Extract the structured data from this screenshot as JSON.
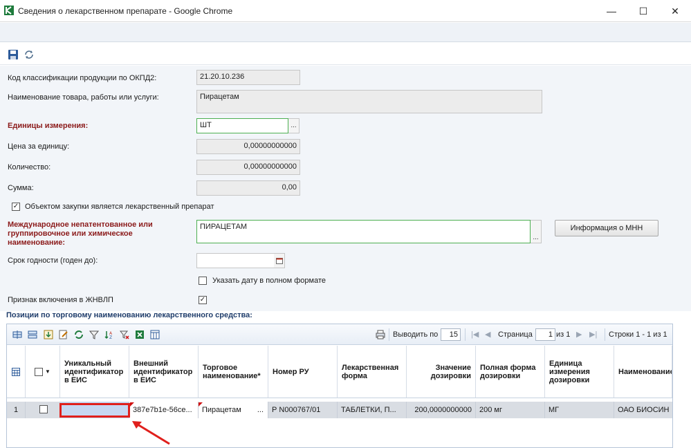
{
  "window": {
    "title": "Сведения о лекарственном препарате - Google Chrome",
    "controls": [
      "—",
      "☐",
      "✕"
    ]
  },
  "form": {
    "okpd2": {
      "label": "Код классификации продукции по ОКПД2:",
      "value": "21.20.10.236"
    },
    "name": {
      "label": "Наименование товара, работы или услуги:",
      "value": "Пирацетам"
    },
    "units": {
      "label": "Единицы измерения:",
      "value": "ШТ"
    },
    "price": {
      "label": "Цена за единицу:",
      "value": "0,00000000000"
    },
    "quantity": {
      "label": "Количество:",
      "value": "0,00000000000"
    },
    "sum": {
      "label": "Сумма:",
      "value": "0,00"
    },
    "is_drug": {
      "label": "Объектом закупки является лекарственный препарат",
      "checked": true
    },
    "mnn": {
      "label": "Международное непатентованное или группировочное или химическое наименование:",
      "value": "ПИРАЦЕТАМ",
      "info_button": "Информация о МНН"
    },
    "expiry": {
      "label": "Срок годности (годен до):",
      "value": ""
    },
    "full_date": {
      "label": "Указать дату в полном формате",
      "checked": false
    },
    "zhnvlp": {
      "label": "Признак включения в ЖНВЛП",
      "checked": true
    },
    "dots": "..."
  },
  "grid": {
    "section_title": "Позиции по торговому наименованию лекарственного средства:",
    "pager": {
      "show_label": "Выводить по",
      "per_page": "15",
      "page_label": "Страница",
      "page": "1",
      "of_label": "из 1",
      "rows_label": "Строки 1 - 1 из 1"
    },
    "columns": [
      "Уникальный идентификатор в ЕИС",
      "Внешний идентификатор в ЕИС",
      "Торговое наименование*",
      "Номер РУ",
      "Лекарственная форма",
      "Значение дозировки",
      "Полная форма дозировки",
      "Единица измерения дозировки",
      "Наименование держателя или владельца РУ"
    ],
    "rows": [
      {
        "num": "1",
        "checked": false,
        "uid": "",
        "ext_id": "387e7b1e-56ce...",
        "trade_name": "Пирацетам",
        "trade_dots": "...",
        "ru_number": "Р N000767/01",
        "form": "ТАБЛЕТКИ, П...",
        "dose_value": "200,0000000000",
        "dose_full": "200 мг",
        "dose_unit": "МГ",
        "holder": "ОАО БИОСИН"
      }
    ]
  },
  "colors": {
    "accent_red": "#e0201c",
    "required_label": "#8b1a1a",
    "section_title": "#1f3d6b"
  }
}
